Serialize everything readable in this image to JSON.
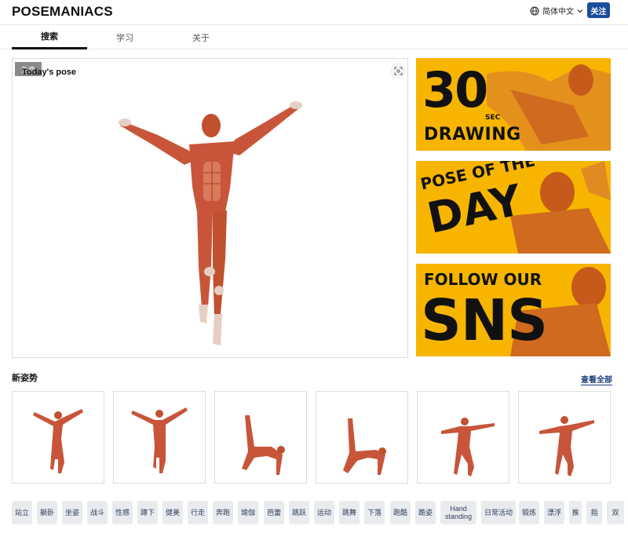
{
  "header": {
    "logo": "POSEMANIACS",
    "language": "简体中文",
    "follow_button": "关注"
  },
  "tabs": [
    {
      "label": "搜索",
      "active": true
    },
    {
      "label": "学习",
      "active": false
    },
    {
      "label": "关于",
      "active": false
    }
  ],
  "today": {
    "badge": "免费",
    "title": "Today's pose"
  },
  "banners": [
    {
      "line1": "30",
      "line1_small": "SEC",
      "line2": "DRAWING"
    },
    {
      "line1": "POSE OF THE",
      "line2": "DAY"
    },
    {
      "line1": "FOLLOW OUR",
      "line2": "SNS"
    }
  ],
  "new_poses": {
    "title": "新姿势",
    "view_all": "查看全部",
    "thumbnails": [
      "pose-1",
      "pose-2",
      "pose-3",
      "pose-4",
      "pose-5",
      "pose-6"
    ]
  },
  "tags": [
    "站立",
    "躺卧",
    "坐姿",
    "战斗",
    "性感",
    "蹲下",
    "健美",
    "行走",
    "奔跑",
    "瑜伽",
    "芭蕾",
    "跳跃",
    "运动",
    "跳舞",
    "下落",
    "跑酷",
    "跪姿",
    "Hand standing",
    "日常活动",
    "锻炼",
    "漂浮",
    "推",
    "指",
    "双"
  ],
  "colors": {
    "accent": "#1a4d9c",
    "banner_yellow": "#f7b500",
    "muscle": "#c8553a",
    "chip_bg": "#e9ebee"
  }
}
